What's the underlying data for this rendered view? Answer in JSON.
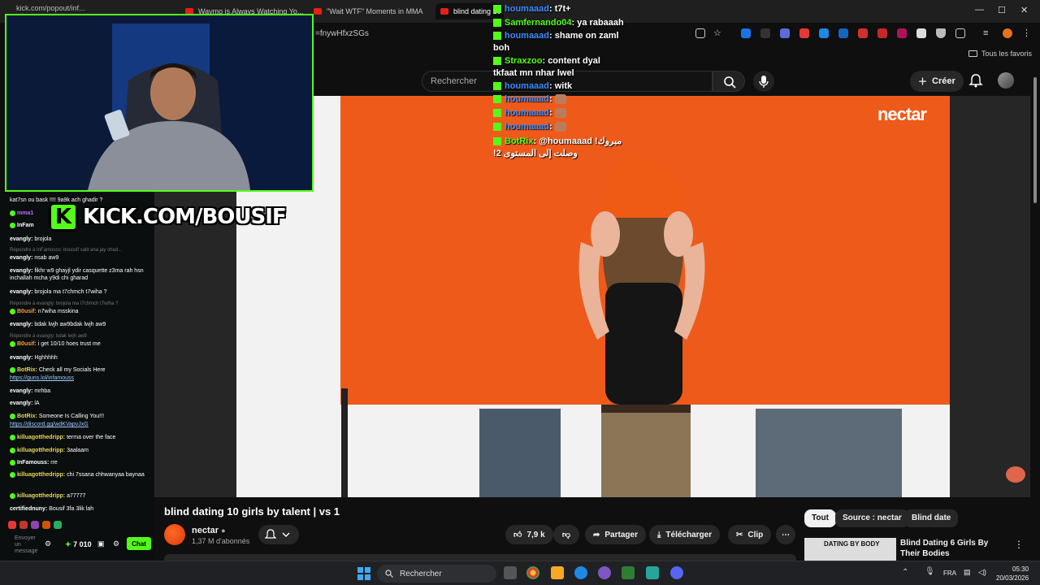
{
  "browser": {
    "tabs": [
      {
        "label": "Waymo is Always Watching Yo..."
      },
      {
        "label": "\"Wait WTF\" Moments in MMA"
      },
      {
        "label": "blind dating 10"
      }
    ],
    "address_tail": "=fnywHfxzSGs",
    "bookmarks_all": "Tous les favoris",
    "popout_title": "kick.com/popout/inf..."
  },
  "youtube": {
    "search_placeholder": "Rechercher",
    "create_label": "Créer",
    "video_logo": "nectar",
    "video_title": "blind dating 10 girls by talent | vs 1",
    "channel_name": "nectar",
    "channel_subs": "1,37 M d'abonnés",
    "likes": "7,9 k",
    "share_label": "Partager",
    "download_label": "Télécharger",
    "clip_label": "Clip",
    "chips": [
      "Tout",
      "Source : nectar",
      "Blind date"
    ],
    "recommended": {
      "title": "Blind Dating 6 Girls By Their Bodies",
      "thumb_text": "DATING BY BODY"
    }
  },
  "kick_banner": {
    "letter": "K",
    "text": "KICK.COM/BOUSIF"
  },
  "side_chat": {
    "lines": [
      {
        "user": "",
        "text": "kat7sn ou bask !!!! 9a9k ach ghadir ?",
        "kind": "msg"
      },
      {
        "user": "mma1",
        "text": "",
        "kind": "msg",
        "color": "g"
      },
      {
        "user": "InFam",
        "text": "",
        "kind": "msg"
      },
      {
        "user": "evangly:",
        "text": "brojola",
        "kind": "msg"
      },
      {
        "user": "",
        "text": "Répondre à InFamouss: bousslf salit ana jay chad...",
        "kind": "reply"
      },
      {
        "user": "evangly:",
        "text": "nsab aw9",
        "kind": "msg"
      },
      {
        "user": "evangly:",
        "text": "fikhr w9 ghayjl ydir casquette z3ma rah hsn inchallah mcha y9di chi gharad",
        "kind": "msg"
      },
      {
        "user": "evangly:",
        "text": "brojola ma t7chmch t7wiha ?",
        "kind": "msg"
      },
      {
        "user": "",
        "text": "Répondre à evangly: brojola ma t7chmch t7wiha ?",
        "kind": "reply"
      },
      {
        "user": "B0usif:",
        "text": "n7wiha msskina",
        "kind": "msg",
        "color": "o"
      },
      {
        "user": "evangly:",
        "text": "bdak lwjh aw9bdak lwjh aw9",
        "kind": "msg"
      },
      {
        "user": "",
        "text": "Répondre à evangly: bdak lwjh aw9",
        "kind": "reply"
      },
      {
        "user": "B0usif:",
        "text": "i get 10/10 hoes trust me",
        "kind": "msg",
        "color": "o"
      },
      {
        "user": "evangly:",
        "text": "Hghhhhh",
        "kind": "msg"
      },
      {
        "user": "BotRix:",
        "text": "Check all my Socials Here",
        "kind": "msg",
        "color": "y"
      },
      {
        "user": "",
        "text": "https://guns.lol/infamouss",
        "kind": "link"
      },
      {
        "user": "evangly:",
        "text": "mrhba",
        "kind": "msg"
      },
      {
        "user": "evangly:",
        "text": "lA",
        "kind": "msg"
      },
      {
        "user": "BotRix:",
        "text": "Someone Is Calling You!!!",
        "kind": "msg",
        "color": "y"
      },
      {
        "user": "",
        "text": "https://discord.gg/wdKVapvJxG",
        "kind": "link"
      },
      {
        "user": "killuagotthedripp:",
        "text": "terma over the face",
        "kind": "msg",
        "color": "y"
      },
      {
        "user": "killuagotthedripp:",
        "text": "3aalaam",
        "kind": "msg",
        "color": "y"
      },
      {
        "user": "InFamouss:",
        "text": "rre",
        "kind": "msg"
      },
      {
        "user": "killuagotthedripp:",
        "text": "chi 7ssana chhwanyaa baynaa",
        "kind": "msg",
        "color": "y"
      },
      {
        "user": "killuagotthedripp:",
        "text": "a77777",
        "kind": "msg",
        "color": "y"
      },
      {
        "user": "certifiednuny:",
        "text": "Bousif 3fa 3lik lah",
        "kind": "msg"
      }
    ],
    "input_placeholder": "Envoyer un message",
    "points": "7 010",
    "chat_button": "Chat"
  },
  "overlay_chat": [
    {
      "user": "houmaaad",
      "text": ": t7t+",
      "color": "b"
    },
    {
      "user": "Samfernando04",
      "text": ":  ya rabaaah",
      "color": "g"
    },
    {
      "user": "houmaaad",
      "text": ":  shame on zaml",
      "color": "b"
    },
    {
      "user": "",
      "text": "boh",
      "color": ""
    },
    {
      "user": "Straxzoo",
      "text": ":  content dyal",
      "color": "g"
    },
    {
      "user": "",
      "text": "tkfaat mn nhar lwel",
      "color": ""
    },
    {
      "user": "houmaaad",
      "text": ":  witk",
      "color": "b"
    },
    {
      "user": "houmaaad",
      "text": ":",
      "color": "b",
      "emote": true
    },
    {
      "user": "houmaaad",
      "text": ":",
      "color": "b",
      "emote": true
    },
    {
      "user": "houmaaad",
      "text": ":",
      "color": "b",
      "emote": true
    },
    {
      "user": "BotRix",
      "text": ":  @houmaaad !مبروك",
      "color": "g"
    },
    {
      "user": "",
      "text": "!وصلت إلى المستوى 2",
      "color": ""
    }
  ],
  "taskbar": {
    "search": "Rechercher",
    "lang": "FRA",
    "time": "05:30",
    "date": "20/03/2026"
  },
  "colors": {
    "kick_green": "#53fc18",
    "video_orange": "#ee5a1a",
    "yt_bg": "#0f0f0f"
  }
}
